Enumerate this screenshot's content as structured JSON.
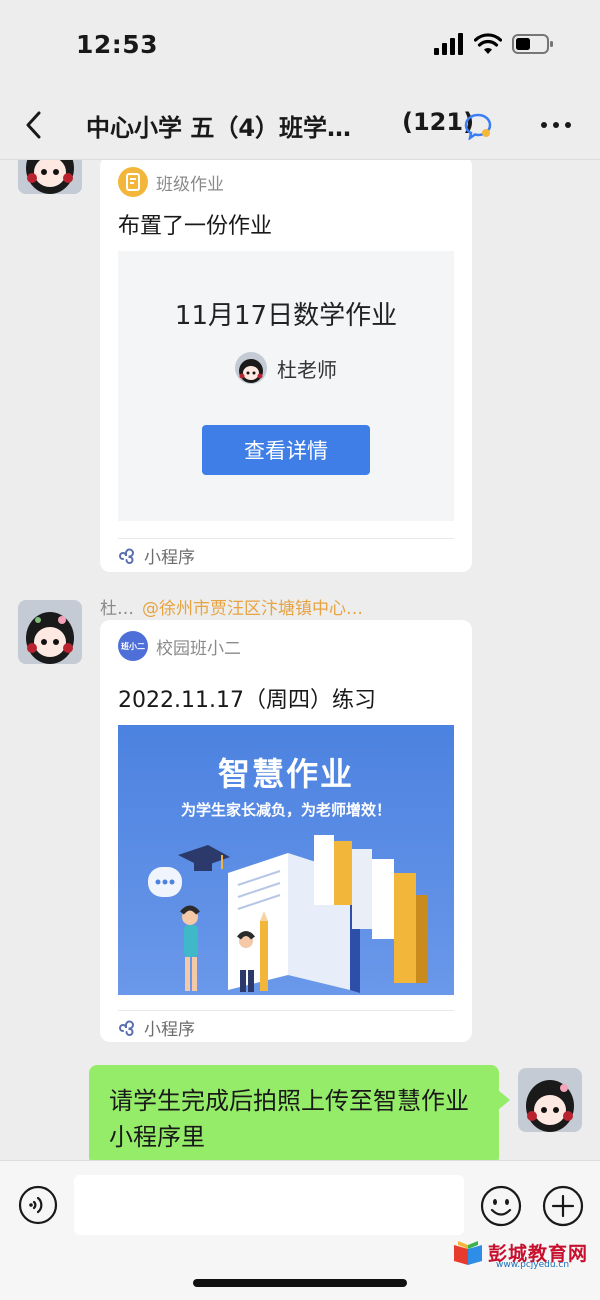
{
  "status": {
    "time": "12:53"
  },
  "header": {
    "title": "中心小学 五（4）班学…",
    "member_count": "(121)"
  },
  "messages": {
    "homework_card": {
      "source": "班级作业",
      "text": "布置了一份作业",
      "panel_title": "11月17日数学作业",
      "teacher": "杜老师",
      "button": "查看详情",
      "footer": "小程序"
    },
    "sender": {
      "name": "杜…",
      "mention": "@徐州市贾汪区汴塘镇中心…"
    },
    "practice_card": {
      "source": "校园班小二",
      "source_logo": "班小二",
      "text": "2022.11.17（周四）练习",
      "promo_title": "智慧作业",
      "promo_subtitle": "为学生家长减负，为老师增效！",
      "footer": "小程序"
    },
    "my_message": {
      "text": "请学生完成后拍照上传至智慧作业小程序里"
    }
  },
  "input": {
    "placeholder": ""
  },
  "watermark": {
    "text": "彭城教育网",
    "url": "www.pcjyedu.cn"
  },
  "colors": {
    "background": "#ededed",
    "my_bubble": "#95ec69",
    "button_blue": "#3f7ee6",
    "mention": "#e7a341"
  },
  "icons": {
    "back": "chevron-left-icon",
    "more": "more-dots-icon",
    "voice": "voice-icon",
    "emoji": "emoji-icon",
    "plus": "plus-icon",
    "mini_program": "mini-program-icon"
  }
}
